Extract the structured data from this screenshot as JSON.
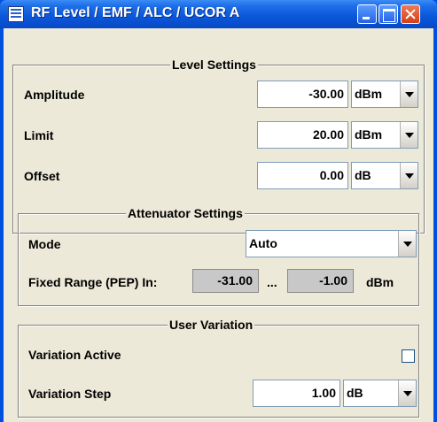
{
  "window": {
    "title": "RF Level / EMF / ALC / UCOR A"
  },
  "level_settings": {
    "title": "Level Settings",
    "amplitude": {
      "label": "Amplitude",
      "value": "-30.00",
      "unit": "dBm"
    },
    "limit": {
      "label": "Limit",
      "value": "20.00",
      "unit": "dBm"
    },
    "offset": {
      "label": "Offset",
      "value": "0.00",
      "unit": "dB"
    }
  },
  "attenuator_settings": {
    "title": "Attenuator Settings",
    "mode": {
      "label": "Mode",
      "value": "Auto"
    },
    "fixed_range": {
      "label": "Fixed Range (PEP) In:",
      "min": "-31.00",
      "separator": "...",
      "max": "-1.00",
      "unit": "dBm"
    }
  },
  "user_variation": {
    "title": "User Variation",
    "variation_active": {
      "label": "Variation Active",
      "checked": false
    },
    "variation_step": {
      "label": "Variation Step",
      "value": "1.00",
      "unit": "dB"
    }
  },
  "icons": {
    "app": "app-window-icon",
    "minimize": "minimize-icon",
    "maximize": "maximize-icon",
    "close": "close-icon",
    "dropdown": "chevron-down-icon"
  },
  "colors": {
    "titlebar": "#0a56da",
    "client_bg": "#ece9d8",
    "readonly_bg": "#c8c8c8",
    "close_button": "#d1401a"
  }
}
